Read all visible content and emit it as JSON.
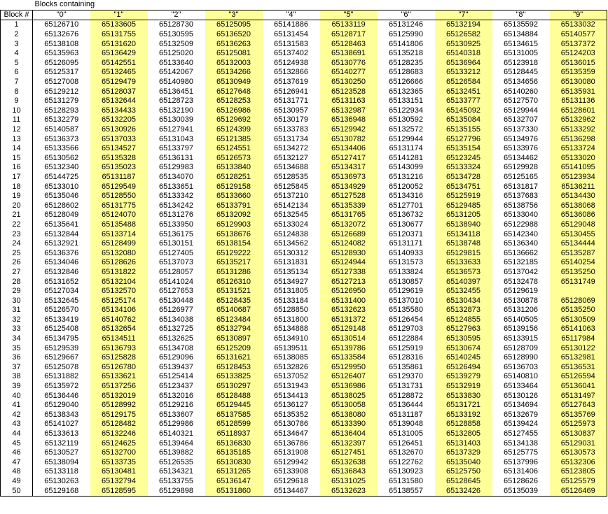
{
  "title": "Blocks containing",
  "row_header": "Block #",
  "column_headers": [
    "\"0\"",
    "\"1\"",
    "\"2\"",
    "\"3\"",
    "\"4\"",
    "\"5\"",
    "\"6\"",
    "\"7\"",
    "\"8\"",
    "\"9\""
  ],
  "highlight_color": "#ffff99",
  "highlighted_columns": [
    "\"1\"",
    "\"3\"",
    "\"5\"",
    "\"7\"",
    "\"9\""
  ],
  "rows": [
    {
      "block": "1",
      "values": [
        "65126710",
        "65133605",
        "65128730",
        "65125095",
        "65141886",
        "65133119",
        "65131246",
        "65132194",
        "65135592",
        "65133032"
      ]
    },
    {
      "block": "2",
      "values": [
        "65132676",
        "65131755",
        "65130595",
        "65136520",
        "65131454",
        "65128717",
        "65125990",
        "65126582",
        "65134884",
        "65140577"
      ]
    },
    {
      "block": "3",
      "values": [
        "65138108",
        "65131620",
        "65132509",
        "65136263",
        "65131583",
        "65128463",
        "65141806",
        "65130925",
        "65134615",
        "65137372"
      ]
    },
    {
      "block": "4",
      "values": [
        "65135963",
        "65136429",
        "65125020",
        "65125081",
        "65137402",
        "65138691",
        "65135218",
        "65140318",
        "65131005",
        "65124203"
      ]
    },
    {
      "block": "5",
      "values": [
        "65126095",
        "65142551",
        "65133640",
        "65132003",
        "65124938",
        "65130776",
        "65128235",
        "65136964",
        "65123918",
        "65136015"
      ]
    },
    {
      "block": "6",
      "values": [
        "65125317",
        "65132465",
        "65142067",
        "65134266",
        "65132866",
        "65140277",
        "65128683",
        "65133212",
        "65128445",
        "65135359"
      ]
    },
    {
      "block": "7",
      "values": [
        "65127008",
        "65129479",
        "65140980",
        "65130949",
        "65137619",
        "65130250",
        "65126666",
        "65126584",
        "65134656",
        "65130080"
      ]
    },
    {
      "block": "8",
      "values": [
        "65129212",
        "65128037",
        "65136451",
        "65127648",
        "65126941",
        "65123528",
        "65132365",
        "65132451",
        "65140260",
        "65135931"
      ]
    },
    {
      "block": "9",
      "values": [
        "65131279",
        "65132644",
        "65128723",
        "65128253",
        "65131771",
        "65131163",
        "65133151",
        "65133777",
        "65127570",
        "65131136"
      ]
    },
    {
      "block": "10",
      "values": [
        "65128293",
        "65134433",
        "65132190",
        "65126986",
        "65130957",
        "65132987",
        "65122934",
        "65145092",
        "65129944",
        "65128601"
      ]
    },
    {
      "block": "11",
      "values": [
        "65132279",
        "65132205",
        "65130039",
        "65129692",
        "65130179",
        "65136948",
        "65130592",
        "65135084",
        "65132707",
        "65132962"
      ]
    },
    {
      "block": "12",
      "values": [
        "65140587",
        "65130926",
        "65127941",
        "65124399",
        "65133783",
        "65129942",
        "65132572",
        "65135155",
        "65137330",
        "65133292"
      ]
    },
    {
      "block": "13",
      "values": [
        "65136373",
        "65137033",
        "65131043",
        "65121385",
        "65131734",
        "65130782",
        "65129944",
        "65127796",
        "65134976",
        "65136298"
      ]
    },
    {
      "block": "14",
      "values": [
        "65133566",
        "65134527",
        "65133797",
        "65124551",
        "65134272",
        "65134406",
        "65131174",
        "65135154",
        "65133976",
        "65133724"
      ]
    },
    {
      "block": "15",
      "values": [
        "65130562",
        "65135328",
        "65136131",
        "65126573",
        "65132127",
        "65127417",
        "65141281",
        "65123245",
        "65134462",
        "65133020"
      ]
    },
    {
      "block": "16",
      "values": [
        "65132340",
        "65135023",
        "65129983",
        "65133840",
        "65134688",
        "65134317",
        "65143099",
        "65133324",
        "65129928",
        "65141095"
      ]
    },
    {
      "block": "17",
      "values": [
        "65144725",
        "65131187",
        "65134070",
        "65128251",
        "65128535",
        "65136973",
        "65131216",
        "65134728",
        "65125165",
        "65123934"
      ]
    },
    {
      "block": "18",
      "values": [
        "65133010",
        "65129549",
        "65133651",
        "65129158",
        "65125845",
        "65134929",
        "65120052",
        "65134751",
        "65131817",
        "65136211"
      ]
    },
    {
      "block": "19",
      "values": [
        "65135046",
        "65128550",
        "65133342",
        "65133660",
        "65137210",
        "65127528",
        "65134316",
        "65125919",
        "65137683",
        "65134430"
      ]
    },
    {
      "block": "20",
      "values": [
        "65128602",
        "65131775",
        "65134242",
        "65133791",
        "65142134",
        "65135339",
        "65127701",
        "65129485",
        "65138756",
        "65138068"
      ]
    },
    {
      "block": "21",
      "values": [
        "65128049",
        "65124070",
        "65131276",
        "65132092",
        "65132545",
        "65131765",
        "65136732",
        "65131205",
        "65133040",
        "65136086"
      ]
    },
    {
      "block": "22",
      "values": [
        "65135641",
        "65135488",
        "65133950",
        "65129903",
        "65133024",
        "65132072",
        "65130677",
        "65138940",
        "65122988",
        "65129048"
      ]
    },
    {
      "block": "23",
      "values": [
        "65132844",
        "65133714",
        "65136175",
        "65138676",
        "65124838",
        "65126689",
        "65120371",
        "65134118",
        "65142340",
        "65130455"
      ]
    },
    {
      "block": "24",
      "values": [
        "65132921",
        "65128499",
        "65130151",
        "65138154",
        "65134562",
        "65124082",
        "65131171",
        "65138748",
        "65136340",
        "65134444"
      ]
    },
    {
      "block": "25",
      "values": [
        "65136376",
        "65132080",
        "65127405",
        "65129222",
        "65130312",
        "65128930",
        "65140933",
        "65129815",
        "65136662",
        "65135287"
      ]
    },
    {
      "block": "26",
      "values": [
        "65134046",
        "65128626",
        "65137073",
        "65135217",
        "65131831",
        "65124944",
        "65131573",
        "65133633",
        "65132185",
        "65140254"
      ]
    },
    {
      "block": "27",
      "values": [
        "65132846",
        "65131822",
        "65128057",
        "65131286",
        "65135134",
        "65127338",
        "65133824",
        "65136573",
        "65137042",
        "65135250"
      ]
    },
    {
      "block": "28",
      "values": [
        "65131652",
        "65132104",
        "65141024",
        "65126310",
        "65134927",
        "65127213",
        "65130857",
        "65140397",
        "65132478",
        "65131749"
      ]
    },
    {
      "block": "29",
      "values": [
        "65127034",
        "65132570",
        "65127653",
        "65131521",
        "65131805",
        "65126950",
        "65129619",
        "65132455",
        "65129619"
      ]
    },
    {
      "block": "30",
      "values": [
        "65132645",
        "65125174",
        "65130448",
        "65128435",
        "65133184",
        "65131400",
        "65137010",
        "65130434",
        "65130878",
        "65128069"
      ]
    },
    {
      "block": "31",
      "values": [
        "65126570",
        "65134106",
        "65126977",
        "65140687",
        "65128850",
        "65132623",
        "65135580",
        "65132873",
        "65131206",
        "65135250"
      ]
    },
    {
      "block": "32",
      "values": [
        "65133419",
        "65140762",
        "65134038",
        "65123484",
        "65131800",
        "65131372",
        "65126454",
        "65124855",
        "65140505",
        "65130509"
      ]
    },
    {
      "block": "33",
      "values": [
        "65125408",
        "65132654",
        "65132725",
        "65132794",
        "65134888",
        "65129148",
        "65129703",
        "65127963",
        "65139156",
        "65141063"
      ]
    },
    {
      "block": "34",
      "values": [
        "65134795",
        "65134511",
        "65132625",
        "65130897",
        "65134910",
        "65130514",
        "65122884",
        "65130595",
        "65133915",
        "65117984"
      ]
    },
    {
      "block": "35",
      "values": [
        "65129539",
        "65136793",
        "65134708",
        "65125209",
        "65139511",
        "65139786",
        "65125919",
        "65130674",
        "65128709",
        "65130122"
      ]
    },
    {
      "block": "36",
      "values": [
        "65129667",
        "65125828",
        "65129096",
        "65131621",
        "65138085",
        "65133584",
        "65128316",
        "65140245",
        "65128990",
        "65132981"
      ]
    },
    {
      "block": "37",
      "values": [
        "65125078",
        "65126780",
        "65139437",
        "65128453",
        "65132826",
        "65129950",
        "65135861",
        "65126494",
        "65136703",
        "65136531"
      ]
    },
    {
      "block": "38",
      "values": [
        "65131882",
        "65133621",
        "65125414",
        "65133825",
        "65137052",
        "65126407",
        "65129370",
        "65139279",
        "65140810",
        "65126594"
      ]
    },
    {
      "block": "39",
      "values": [
        "65135972",
        "65137256",
        "65123437",
        "65130297",
        "65131943",
        "65136986",
        "65131731",
        "65132919",
        "65133464",
        "65136041"
      ]
    },
    {
      "block": "40",
      "values": [
        "65136446",
        "65132019",
        "65132016",
        "65128488",
        "65134413",
        "65138025",
        "65128872",
        "65133830",
        "65130126",
        "65131497"
      ]
    },
    {
      "block": "41",
      "values": [
        "65129040",
        "65128992",
        "65129216",
        "65129445",
        "65136127",
        "65130058",
        "65136444",
        "65131721",
        "65134694",
        "65127643"
      ]
    },
    {
      "block": "42",
      "values": [
        "65138343",
        "65129175",
        "65133607",
        "65137585",
        "65135352",
        "65138080",
        "65131187",
        "65133192",
        "65132679",
        "65135769"
      ]
    },
    {
      "block": "43",
      "values": [
        "65141027",
        "65128482",
        "65129986",
        "65128599",
        "65130786",
        "65133390",
        "65139048",
        "65128858",
        "65139424",
        "65125973"
      ]
    },
    {
      "block": "44",
      "values": [
        "65133613",
        "65132246",
        "65140321",
        "65118937",
        "65134647",
        "65136404",
        "65131005",
        "65132805",
        "65127455",
        "65130837"
      ]
    },
    {
      "block": "45",
      "values": [
        "65132119",
        "65124625",
        "65139464",
        "65136830",
        "65136786",
        "65132397",
        "65126451",
        "65131403",
        "65134138",
        "65129031"
      ]
    },
    {
      "block": "46",
      "values": [
        "65130527",
        "65132700",
        "65139882",
        "65135185",
        "65131908",
        "65127451",
        "65132670",
        "65137329",
        "65125775",
        "65130573"
      ]
    },
    {
      "block": "47",
      "values": [
        "65138094",
        "65133735",
        "65126535",
        "65130830",
        "65129942",
        "65132638",
        "65122762",
        "65135040",
        "65137996",
        "65132306"
      ]
    },
    {
      "block": "48",
      "values": [
        "65133118",
        "65130481",
        "65134321",
        "65131265",
        "65133908",
        "65136843",
        "65130923",
        "65125750",
        "65131406",
        "65123805"
      ]
    },
    {
      "block": "49",
      "values": [
        "65130263",
        "65132794",
        "65133755",
        "65136147",
        "65129618",
        "65131025",
        "65131580",
        "65128645",
        "65128626",
        "65125579"
      ]
    },
    {
      "block": "50",
      "values": [
        "65129168",
        "65128595",
        "65129898",
        "65131860",
        "65134467",
        "65132623",
        "65138557",
        "65132426",
        "65135039",
        "65126469"
      ]
    }
  ]
}
